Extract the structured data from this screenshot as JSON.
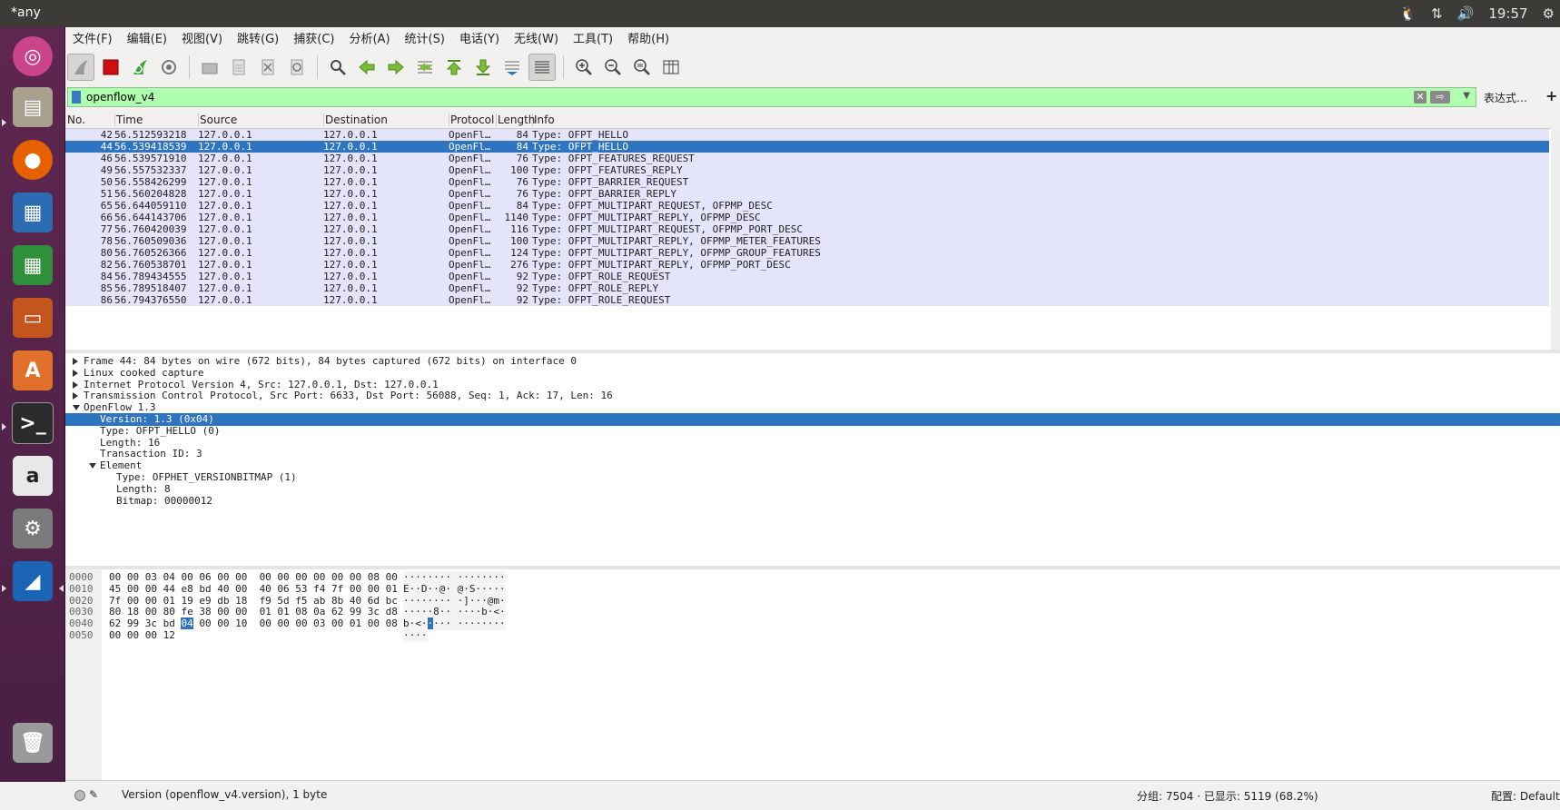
{
  "window": {
    "title": "*any"
  },
  "topbar": {
    "time": "19:57"
  },
  "menu": [
    "文件(F)",
    "编辑(E)",
    "视图(V)",
    "跳转(G)",
    "捕获(C)",
    "分析(A)",
    "统计(S)",
    "电话(Y)",
    "无线(W)",
    "工具(T)",
    "帮助(H)"
  ],
  "filter": {
    "value": "openflow_v4",
    "expression_label": "表达式…",
    "plus_label": "+"
  },
  "columns": [
    "No.",
    "Time",
    "Source",
    "Destination",
    "Protocol",
    "Length",
    "Info"
  ],
  "packets": [
    {
      "no": "42",
      "time": "56.512593218",
      "src": "127.0.0.1",
      "dst": "127.0.0.1",
      "proto": "OpenFl…",
      "len": "84",
      "info": "Type: OFPT_HELLO"
    },
    {
      "no": "44",
      "time": "56.539418539",
      "src": "127.0.0.1",
      "dst": "127.0.0.1",
      "proto": "OpenFl…",
      "len": "84",
      "info": "Type: OFPT_HELLO"
    },
    {
      "no": "46",
      "time": "56.539571910",
      "src": "127.0.0.1",
      "dst": "127.0.0.1",
      "proto": "OpenFl…",
      "len": "76",
      "info": "Type: OFPT_FEATURES_REQUEST"
    },
    {
      "no": "49",
      "time": "56.557532337",
      "src": "127.0.0.1",
      "dst": "127.0.0.1",
      "proto": "OpenFl…",
      "len": "100",
      "info": "Type: OFPT_FEATURES_REPLY"
    },
    {
      "no": "50",
      "time": "56.558426299",
      "src": "127.0.0.1",
      "dst": "127.0.0.1",
      "proto": "OpenFl…",
      "len": "76",
      "info": "Type: OFPT_BARRIER_REQUEST"
    },
    {
      "no": "51",
      "time": "56.560204828",
      "src": "127.0.0.1",
      "dst": "127.0.0.1",
      "proto": "OpenFl…",
      "len": "76",
      "info": "Type: OFPT_BARRIER_REPLY"
    },
    {
      "no": "65",
      "time": "56.644059110",
      "src": "127.0.0.1",
      "dst": "127.0.0.1",
      "proto": "OpenFl…",
      "len": "84",
      "info": "Type: OFPT_MULTIPART_REQUEST, OFPMP_DESC"
    },
    {
      "no": "66",
      "time": "56.644143706",
      "src": "127.0.0.1",
      "dst": "127.0.0.1",
      "proto": "OpenFl…",
      "len": "1140",
      "info": "Type: OFPT_MULTIPART_REPLY, OFPMP_DESC"
    },
    {
      "no": "77",
      "time": "56.760420039",
      "src": "127.0.0.1",
      "dst": "127.0.0.1",
      "proto": "OpenFl…",
      "len": "116",
      "info": "Type: OFPT_MULTIPART_REQUEST, OFPMP_PORT_DESC"
    },
    {
      "no": "78",
      "time": "56.760509036",
      "src": "127.0.0.1",
      "dst": "127.0.0.1",
      "proto": "OpenFl…",
      "len": "100",
      "info": "Type: OFPT_MULTIPART_REPLY, OFPMP_METER_FEATURES"
    },
    {
      "no": "80",
      "time": "56.760526366",
      "src": "127.0.0.1",
      "dst": "127.0.0.1",
      "proto": "OpenFl…",
      "len": "124",
      "info": "Type: OFPT_MULTIPART_REPLY, OFPMP_GROUP_FEATURES"
    },
    {
      "no": "82",
      "time": "56.760538701",
      "src": "127.0.0.1",
      "dst": "127.0.0.1",
      "proto": "OpenFl…",
      "len": "276",
      "info": "Type: OFPT_MULTIPART_REPLY, OFPMP_PORT_DESC"
    },
    {
      "no": "84",
      "time": "56.789434555",
      "src": "127.0.0.1",
      "dst": "127.0.0.1",
      "proto": "OpenFl…",
      "len": "92",
      "info": "Type: OFPT_ROLE_REQUEST"
    },
    {
      "no": "85",
      "time": "56.789518407",
      "src": "127.0.0.1",
      "dst": "127.0.0.1",
      "proto": "OpenFl…",
      "len": "92",
      "info": "Type: OFPT_ROLE_REPLY"
    },
    {
      "no": "86",
      "time": "56.794376550",
      "src": "127.0.0.1",
      "dst": "127.0.0.1",
      "proto": "OpenFl…",
      "len": "92",
      "info": "Type: OFPT_ROLE_REQUEST"
    }
  ],
  "details": [
    {
      "text": "Frame 44: 84 bytes on wire (672 bits), 84 bytes captured (672 bits) on interface 0",
      "level": 0,
      "tree": "closed"
    },
    {
      "text": "Linux cooked capture",
      "level": 0,
      "tree": "closed"
    },
    {
      "text": "Internet Protocol Version 4, Src: 127.0.0.1, Dst: 127.0.0.1",
      "level": 0,
      "tree": "closed"
    },
    {
      "text": "Transmission Control Protocol, Src Port: 6633, Dst Port: 56088, Seq: 1, Ack: 17, Len: 16",
      "level": 0,
      "tree": "closed"
    },
    {
      "text": "OpenFlow 1.3",
      "level": 0,
      "tree": "open"
    },
    {
      "text": "Version: 1.3 (0x04)",
      "level": 1,
      "tree": "none",
      "selected": true
    },
    {
      "text": "Type: OFPT_HELLO (0)",
      "level": 1,
      "tree": "none"
    },
    {
      "text": "Length: 16",
      "level": 1,
      "tree": "none"
    },
    {
      "text": "Transaction ID: 3",
      "level": 1,
      "tree": "none"
    },
    {
      "text": "Element",
      "level": 1,
      "tree": "open"
    },
    {
      "text": "Type: OFPHET_VERSIONBITMAP (1)",
      "level": 2,
      "tree": "none"
    },
    {
      "text": "Length: 8",
      "level": 2,
      "tree": "none"
    },
    {
      "text": "Bitmap: 00000012",
      "level": 2,
      "tree": "none"
    }
  ],
  "bytes": [
    {
      "offset": "0000",
      "hex": "00 00 03 04 00 06 00 00  00 00 00 00 00 00 08 00",
      "ascii": "········ ········"
    },
    {
      "offset": "0010",
      "hex": "45 00 00 44 e8 bd 40 00  40 06 53 f4 7f 00 00 01",
      "ascii": "E··D··@· @·S·····"
    },
    {
      "offset": "0020",
      "hex": "7f 00 00 01 19 e9 db 18  f9 5d f5 ab 8b 40 6d bc",
      "ascii": "········ ·]···@m·"
    },
    {
      "offset": "0030",
      "hex": "80 18 00 80 fe 38 00 00  01 01 08 0a 62 99 3c d8",
      "ascii": "·····8·· ····b·<·"
    },
    {
      "offset": "0040",
      "hex_before": "62 99 3c bd ",
      "hex_hl": "04",
      "hex_after": " 00 00 10  00 00 00 03 00 01 00 08",
      "ascii_before": "b·<·",
      "ascii_hl": "·",
      "ascii_after": "··· ········"
    },
    {
      "offset": "0050",
      "hex": "00 00 00 12",
      "ascii": "····"
    }
  ],
  "status": {
    "edit_icon": "pencil-icon",
    "field_info": "Version (openflow_v4.version), 1 byte",
    "packets_info": "分组: 7504 · 已显示: 5119 (68.2%)",
    "profile": "配置: Default"
  }
}
